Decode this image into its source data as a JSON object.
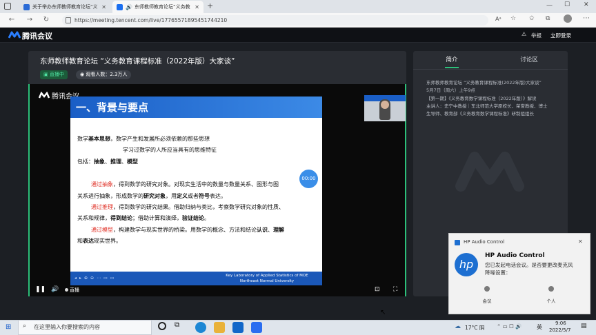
{
  "browser": {
    "tabs": [
      {
        "title": "关于举办东师教师教育论坛“义务教...",
        "active": false
      },
      {
        "title": "东师教师教育论坛“义务教...",
        "active": true
      }
    ],
    "new_tab": "+",
    "url": "https://meeting.tencent.com/live/17765571895451744210"
  },
  "app": {
    "name": "腾讯会议",
    "report": "举报",
    "login": "立即登录"
  },
  "live": {
    "title": "东师教师教育论坛 “义务教育课程标准（2022年版）大家谈”",
    "status": "直播中",
    "viewers": "观看人数：2.3万人",
    "timer": "00:00",
    "control_live": "直播",
    "watermark": "腾讯会议"
  },
  "slide": {
    "heading": "一、背景与要点",
    "lines": [
      [
        "数学",
        "基本思想",
        "，数学产生和发展所必须依赖的那些思想"
      ],
      [
        "学习过数学的人所应当具有的思维特征"
      ],
      [
        "包括：",
        "抽象",
        "、",
        "推理",
        "、",
        "模型"
      ],
      [
        "通过抽象",
        "，得到数学的研究对象。对现实生活中的数量与数量关系、图形与图"
      ],
      [
        "关系进行抽象，形成数学的",
        "研究对象",
        "，用",
        "定义",
        "或者",
        "符号",
        "表达。"
      ],
      [
        "通过推理",
        "，得到数学的研究结果。借助归纳与类比，考察数学研究对象的性质、"
      ],
      [
        "关系和规律，",
        "得到结论",
        "；借助计算和演绎，",
        "验证结论",
        "。"
      ],
      [
        "通过模型",
        "，构建数学与现实世界的桥梁。用数学的概念、方法和结论",
        "认识",
        "、",
        "理解"
      ],
      [
        "和",
        "表达",
        "现实世界。"
      ]
    ],
    "footer_line1": "Key Laboratory of Applied Statistics of MOE",
    "footer_line2": "Northeast Normal University"
  },
  "panel": {
    "tab_intro": "简介",
    "tab_discussion": "讨论区",
    "intro_lines": [
      "东师教师教育论坛 “义务教育课程标准(2022年版)大家谈”",
      "5月7日（周六）上午9点",
      "【第一期】《义务教育数学课程标准（2022年版）》解读",
      "主讲人：史宁中教授｜东北师范大学原校长、荣誉教授、博士",
      "生导师、教育部《义务教育数学课程标准》研制组组长"
    ]
  },
  "notification": {
    "app": "HP Audio Control",
    "title": "HP Audio Control",
    "body_line1": "您已发起电话会议。是否要更改麦克风",
    "body_line2": "降噪设置：",
    "option1": "会议",
    "option2": "个人"
  },
  "taskbar": {
    "search_placeholder": "在这里输入你要搜索的内容",
    "weather": "17°C 阴",
    "ime": "英",
    "time": "9:06",
    "date": "2022/5/7"
  }
}
